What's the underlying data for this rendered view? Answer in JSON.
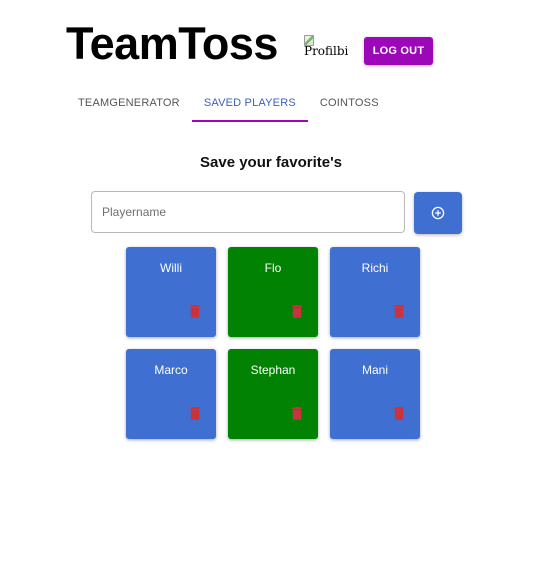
{
  "header": {
    "title": "TeamToss",
    "profile_image_alt": "Profilbi",
    "logout_label": "LOG OUT"
  },
  "tabs": [
    {
      "label": "TEAMGENERATOR",
      "active": false
    },
    {
      "label": "SAVED PLAYERS",
      "active": true
    },
    {
      "label": "COINTOSS",
      "active": false
    }
  ],
  "main": {
    "heading": "Save your favorite's",
    "input_placeholder": "Playername",
    "input_value": ""
  },
  "icons": {
    "add": "plus-circle-icon",
    "delete": "trash-icon",
    "profile": "broken-image-icon"
  },
  "colors": {
    "accent": "#9c08b8",
    "tab_active_text": "#3b5fbf",
    "primary_blue": "#3f6fd1",
    "green": "#028202",
    "delete_red": "#c8333d"
  },
  "players": [
    {
      "name": "Willi",
      "color": "#3f6fd1"
    },
    {
      "name": "Flo",
      "color": "#028202"
    },
    {
      "name": "Richi",
      "color": "#3f6fd1"
    },
    {
      "name": "Marco",
      "color": "#3f6fd1"
    },
    {
      "name": "Stephan",
      "color": "#028202"
    },
    {
      "name": "Mani",
      "color": "#3f6fd1"
    }
  ]
}
